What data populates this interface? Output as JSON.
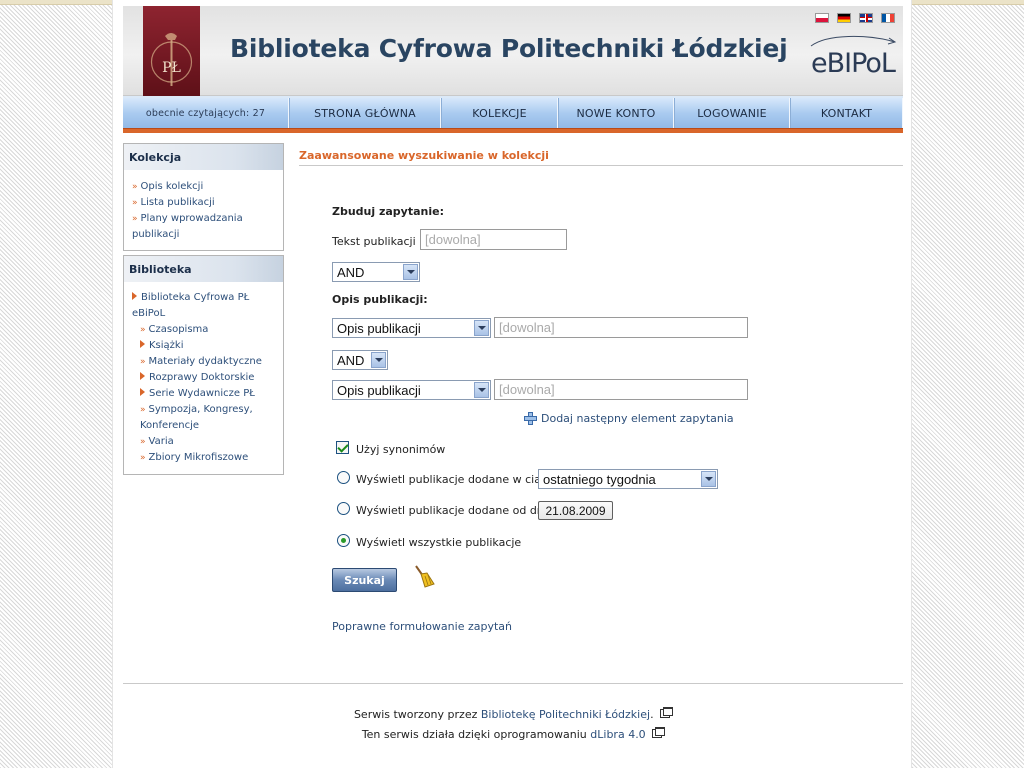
{
  "header": {
    "title": "Biblioteka Cyfrowa Politechniki Łódzkiej",
    "logo_text": "PŁ",
    "brand": "eBIPoL",
    "flags": [
      "pl",
      "de",
      "en",
      "fr"
    ]
  },
  "nav": {
    "readers": "obecnie czytających: 27",
    "items": [
      "STRONA GŁÓWNA",
      "KOLEKCJE",
      "NOWE KONTO",
      "LOGOWANIE",
      "KONTAKT"
    ]
  },
  "sidebar": {
    "kolekcja": {
      "title": "Kolekcja",
      "items": [
        "Opis kolekcji",
        "Lista publikacji",
        "Plany wprowadzania publikacji"
      ]
    },
    "biblioteka": {
      "title": "Biblioteka",
      "root": "Biblioteka Cyfrowa PŁ eBiPoL",
      "items": [
        {
          "label": "Czasopisma",
          "marker": "raquo"
        },
        {
          "label": "Książki",
          "marker": "triangle"
        },
        {
          "label": "Materiały dydaktyczne",
          "marker": "raquo"
        },
        {
          "label": "Rozprawy Doktorskie",
          "marker": "triangle"
        },
        {
          "label": "Serie Wydawnicze PŁ",
          "marker": "triangle"
        },
        {
          "label": "Sympozja, Kongresy, Konferencje",
          "marker": "raquo"
        },
        {
          "label": "Varia",
          "marker": "raquo"
        },
        {
          "label": "Zbiory Mikrofiszowe",
          "marker": "raquo"
        }
      ]
    }
  },
  "main": {
    "title": "Zaawansowane wyszukiwanie w kolekcji",
    "build_query": "Zbuduj zapytanie:",
    "text_label": "Tekst publikacji :",
    "text_placeholder": "[dowolna]",
    "operator1": "AND",
    "desc_label": "Opis publikacji:",
    "field1": "Opis publikacji",
    "field1_placeholder": "[dowolna]",
    "operator2": "AND",
    "field2": "Opis publikacji",
    "field2_placeholder": "[dowolna]",
    "add_element": "Dodaj następny element zapytania",
    "use_synonyms": "Użyj synonimów",
    "option_period": "Wyświetl publikacje dodane w ciągu",
    "period_value": "ostatniego tygodnia",
    "option_since": "Wyświetl publikacje dodane od dnia",
    "since_date": "21.08.2009",
    "option_all": "Wyświetl wszystkie publikacje",
    "search_button": "Szukaj",
    "help_link": "Poprawne formułowanie zapytań"
  },
  "footer": {
    "line1_prefix": "Serwis tworzony przez",
    "line1_link": "Bibliotekę Politechniki Łódzkiej",
    "line1_suffix": ".",
    "line2_prefix": "Ten serwis działa dzięki oprogramowaniu",
    "line2_link": "dLibra 4.0"
  },
  "colors": {
    "accent": "#d9662a",
    "link": "#2d4f7a",
    "title": "#2a4562",
    "nav": "#aacbf0"
  }
}
